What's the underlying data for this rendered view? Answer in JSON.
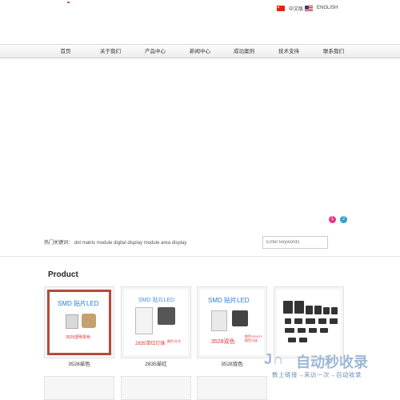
{
  "header": {
    "lang_cn": "中文版",
    "lang_en": "ENGLISH"
  },
  "nav": {
    "items": [
      {
        "label": "首页"
      },
      {
        "label": "关于我们"
      },
      {
        "label": "产品中心"
      },
      {
        "label": "新闻中心"
      },
      {
        "label": "成功案例"
      },
      {
        "label": "技术支持"
      },
      {
        "label": "联系我们"
      }
    ]
  },
  "banner": {
    "dots": [
      "1",
      "2"
    ]
  },
  "keywords": {
    "label": "热门关键词：",
    "text": "dot matrix module digital display module area display"
  },
  "search": {
    "placeholder": "Enter keywords"
  },
  "product": {
    "title": "Product",
    "cards": [
      {
        "label": "3528单色",
        "thumb_title": "SMD 贴片LED",
        "thumb_sub": "3528透明单色"
      },
      {
        "label": "2835单红",
        "thumb_title": "SMD 贴片LED",
        "thumb_sub": "2835单红灯珠",
        "thumb_note": "颜色 红光"
      },
      {
        "label": "3528双色",
        "thumb_title": "SMD 贴片LED",
        "thumb_sub": "3528双色",
        "thumb_note": "颜色 RG/GY 颜色可选"
      },
      {
        "label": "",
        "thumb_title": "",
        "thumb_sub": ""
      }
    ]
  },
  "watermark": {
    "logo": "J∩",
    "main": "自动秒收录",
    "sub": "数上链接→来访一次→自动收录"
  },
  "colors": {
    "accent_pink": "#e8338c",
    "accent_blue": "#2aa3c9",
    "nav_bg": "#ececec"
  }
}
